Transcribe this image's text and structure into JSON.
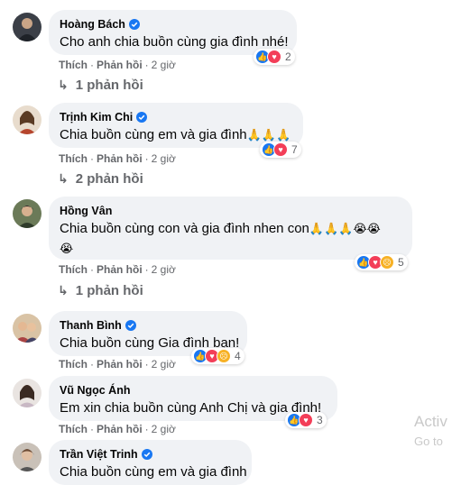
{
  "comments": [
    {
      "name": "Hoàng Bách",
      "text": "Cho anh chia buồn cùng gia đình nhé!",
      "emoji": "",
      "react_count": "2",
      "reactions": [
        "like",
        "love"
      ],
      "like": "Thích",
      "reply": "Phản hồi",
      "time": "2 giờ",
      "replies": "1 phản hồi"
    },
    {
      "name": "Trịnh Kim Chi",
      "text": "Chia buồn cùng em và gia đình",
      "emoji": "🙏🙏🙏",
      "react_count": "7",
      "reactions": [
        "like",
        "love"
      ],
      "like": "Thích",
      "reply": "Phản hồi",
      "time": "2 giờ",
      "replies": "2 phản hồi"
    },
    {
      "name": "Hồng Vân",
      "text": "Chia buồn cùng con và gia đình nhen con",
      "emoji": "🙏🙏🙏😭😭",
      "emoji2": "😭",
      "react_count": "5",
      "reactions": [
        "like",
        "love",
        "sad"
      ],
      "like": "Thích",
      "reply": "Phản hồi",
      "time": "2 giờ",
      "replies": "1 phản hồi"
    },
    {
      "name": "Thanh Bình",
      "text": "Chia buồn cùng Gia đình bạn!",
      "emoji": "",
      "react_count": "4",
      "reactions": [
        "like",
        "love",
        "sad"
      ],
      "like": "Thích",
      "reply": "Phản hồi",
      "time": "2 giờ"
    },
    {
      "name": "Vũ Ngọc Ánh",
      "text": "Em xin chia buồn cùng Anh Chị và gia đình!",
      "emoji": "",
      "react_count": "3",
      "reactions": [
        "like",
        "love"
      ],
      "like": "Thích",
      "reply": "Phản hồi",
      "time": "2 giờ"
    },
    {
      "name": "Trần Việt Trinh",
      "text": "Chia buồn cùng em và gia đình",
      "emoji": ""
    }
  ],
  "watermark": {
    "line1": "Activ",
    "line2": "Go to"
  },
  "icons": {
    "reply_arrow": "reply-arrow-icon",
    "verified": "verified-badge-icon"
  },
  "colors": {
    "like": "#1877f2",
    "love": "#f33e58",
    "sad": "#f7b125",
    "bubble": "#f0f2f5",
    "meta": "#65676b"
  }
}
